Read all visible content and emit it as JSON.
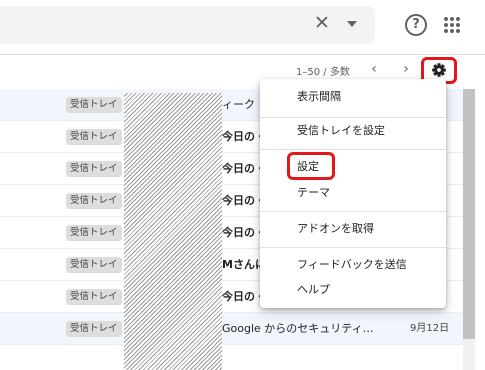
{
  "header": {
    "clear_icon": "close-icon",
    "options_icon": "caret-down-icon",
    "help_icon": "help-circle-icon",
    "help_glyph": "?",
    "apps_icon": "grid-icon"
  },
  "toolbar": {
    "pager": "1–50 / 多数",
    "prev_icon": "chevron-left-icon",
    "next_icon": "chevron-right-icon",
    "settings_icon": "gear-icon",
    "highlight_color": "#e0191b"
  },
  "mail_rows": [
    {
      "label": "受信トレイ",
      "subject": "ィーク",
      "date": "",
      "read": true
    },
    {
      "label": "受信トレイ",
      "subject": "今日の・",
      "date": "",
      "read": false
    },
    {
      "label": "受信トレイ",
      "subject": "今日の・",
      "date": "",
      "read": false
    },
    {
      "label": "受信トレイ",
      "subject": "今日の・",
      "date": "",
      "read": false
    },
    {
      "label": "受信トレイ",
      "subject": "今日の・",
      "date": "",
      "read": false
    },
    {
      "label": "受信トレイ",
      "subject": "Mさんに",
      "date": "",
      "read": false
    },
    {
      "label": "受信トレイ",
      "subject": "今日の・",
      "date": "",
      "read": false
    },
    {
      "label": "受信トレイ",
      "subject": "Google からのセキュリティ…",
      "date": "9月12日",
      "read": true
    }
  ],
  "settings_menu": {
    "items": [
      {
        "label": "表示間隔"
      },
      {
        "label": "受信トレイを設定"
      },
      {
        "label": "設定"
      },
      {
        "label": "テーマ"
      },
      {
        "label": "アドオンを取得"
      },
      {
        "label": "フィードバックを送信"
      },
      {
        "label": "ヘルプ"
      }
    ]
  }
}
